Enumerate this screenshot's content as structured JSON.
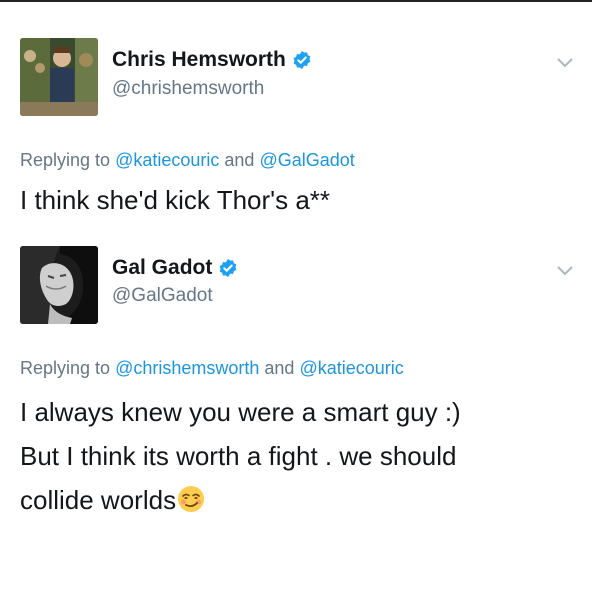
{
  "tweets": [
    {
      "name": "Chris Hemsworth",
      "handle": "@chrishemsworth",
      "replying_prefix": "Replying to",
      "mention1": "@katiecouric",
      "conj": "and",
      "mention2": "@GalGadot",
      "lines": [
        "I think she'd kick Thor's a**"
      ]
    },
    {
      "name": "Gal Gadot",
      "handle": "@GalGadot",
      "replying_prefix": "Replying to",
      "mention1": "@chrishemsworth",
      "conj": "and",
      "mention2": "@katiecouric",
      "lines": [
        "I always knew you were a smart guy :)",
        "But I think its worth a fight . we should",
        "collide worlds"
      ],
      "emoji": "smirking-face-emoji"
    }
  ],
  "colors": {
    "verified": "#1da1f2",
    "link": "#1b95e0",
    "muted": "#657786",
    "text": "#14171a"
  }
}
